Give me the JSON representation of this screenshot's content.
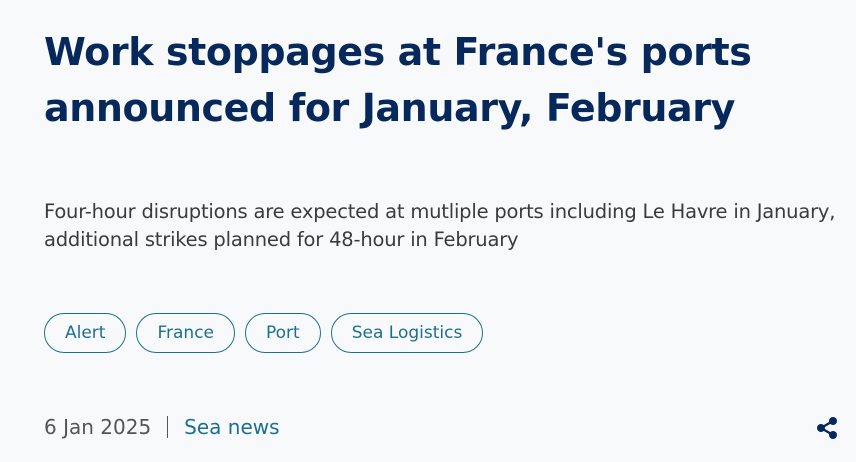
{
  "article": {
    "title": "Work stoppages at France's ports announced for January, February",
    "subtitle": "Four-hour disruptions are expected at mutliple ports including Le Havre in January, additional strikes planned for 48-hour in February",
    "tags": [
      {
        "label": "Alert"
      },
      {
        "label": "France"
      },
      {
        "label": "Port"
      },
      {
        "label": "Sea Logistics"
      }
    ],
    "date": "6 Jan 2025",
    "category": "Sea news",
    "share_icon": "share-icon"
  },
  "colors": {
    "title": "#07285a",
    "accent": "#1c6f93",
    "body_text": "#3b3b3b",
    "background": "#f8f9fa"
  }
}
